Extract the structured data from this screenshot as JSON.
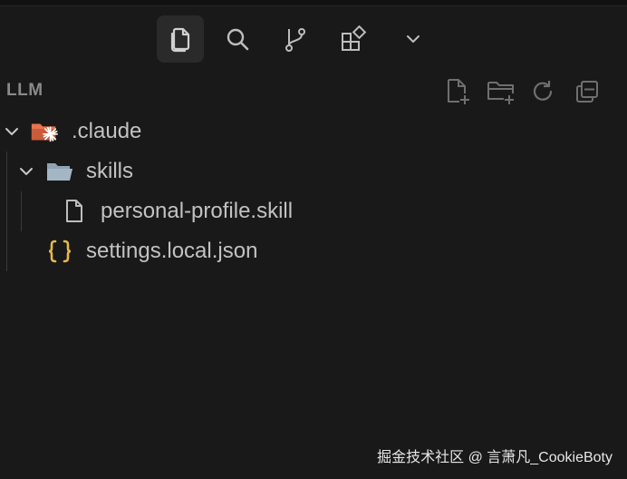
{
  "activity_bar": {
    "items": [
      {
        "id": "explorer",
        "icon": "files-icon",
        "active": true
      },
      {
        "id": "search",
        "icon": "search-icon",
        "active": false
      },
      {
        "id": "source-control",
        "icon": "source-control-icon",
        "active": false
      },
      {
        "id": "extensions",
        "icon": "extensions-icon",
        "active": false
      },
      {
        "id": "more",
        "icon": "chevron-down-icon",
        "active": false
      }
    ]
  },
  "explorer": {
    "section_title": "LLM",
    "actions": [
      "new-file-icon",
      "new-folder-icon",
      "refresh-icon",
      "collapse-all-icon"
    ],
    "tree": [
      {
        "label": ".claude",
        "type": "folder",
        "expanded": true,
        "icon": "claude-folder-icon"
      },
      {
        "label": "skills",
        "type": "folder",
        "expanded": true,
        "icon": "folder-open-icon"
      },
      {
        "label": "personal-profile.skill",
        "type": "file",
        "icon": "file-icon"
      },
      {
        "label": "settings.local.json",
        "type": "file",
        "icon": "json-braces-icon"
      }
    ]
  },
  "colors": {
    "background": "#191919",
    "active_tab": "#2a2a2a",
    "claude_folder": "#e8744f",
    "folder": "#8fa3b3",
    "json": "#e8b84a"
  },
  "watermark": "掘金技术社区 @ 言萧凡_CookieBoty"
}
